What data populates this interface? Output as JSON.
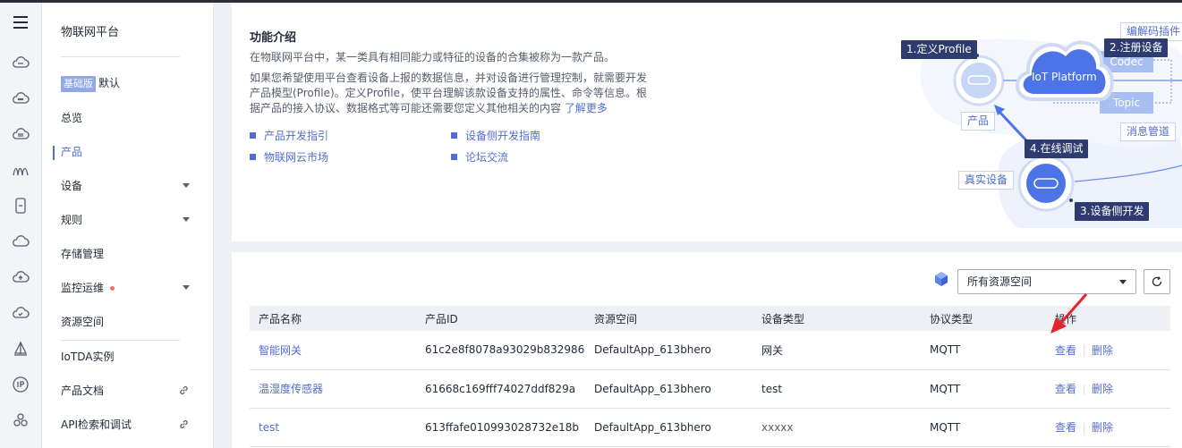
{
  "sidebar": {
    "title": "物联网平台",
    "edition_badge": "基础版",
    "edition_name": "默认",
    "items": [
      {
        "label": "总览"
      },
      {
        "label": "产品"
      },
      {
        "label": "设备"
      },
      {
        "label": "规则"
      },
      {
        "label": "存储管理"
      },
      {
        "label": "监控运维"
      },
      {
        "label": "资源空间"
      },
      {
        "label": "IoTDA实例"
      },
      {
        "label": "产品文档"
      },
      {
        "label": "API检索和调试"
      }
    ]
  },
  "intro": {
    "title": "功能介绍",
    "p1": "在物联网平台中，某一类具有相同能力或特征的设备的合集被称为一款产品。",
    "p2": "如果您希望使用平台查看设备上报的数据信息，并对设备进行管理控制，就需要开发产品模型(Profile)。定义Profile，使平台理解该款设备支持的属性、命令等信息。根据产品的接入协议、数据格式等可能还需要您定义其他相关的内容",
    "learn_more": "了解更多",
    "links": [
      "产品开发指引",
      "设备侧开发指南",
      "物联网云市场",
      "论坛交流"
    ]
  },
  "diagram": {
    "step1": "1.定义Profile",
    "step2": "2.注册设备",
    "step3": "3.设备侧开发",
    "step4": "4.在线调试",
    "codec_plugin": "编解码插件",
    "codec": "Codec",
    "topic": "Topic",
    "msg_channel": "消息管道",
    "product": "产品",
    "real_device": "真实设备",
    "platform": "IoT Platform"
  },
  "toolbar": {
    "resource_select": "所有资源空间"
  },
  "table": {
    "headers": [
      "产品名称",
      "产品ID",
      "资源空间",
      "设备类型",
      "协议类型",
      "操作"
    ],
    "rows": [
      {
        "name": "智能网关",
        "id": "61c2e8f8078a93029b832986",
        "space": "DefaultApp_613bhero",
        "type": "网关",
        "protocol": "MQTT",
        "view": "查看",
        "delete": "删除"
      },
      {
        "name": "温湿度传感器",
        "id": "61668c169fff74027ddf829a",
        "space": "DefaultApp_613bhero",
        "type": "test",
        "protocol": "MQTT",
        "view": "查看",
        "delete": "删除"
      },
      {
        "name": "test",
        "id": "613ffafe010993028732e18b",
        "space": "DefaultApp_613bhero",
        "type": "xxxxx",
        "protocol": "MQTT",
        "view": "查看",
        "delete": "删除"
      }
    ]
  },
  "colors": {
    "accent": "#526ecc",
    "arrow": "#e8222d"
  }
}
